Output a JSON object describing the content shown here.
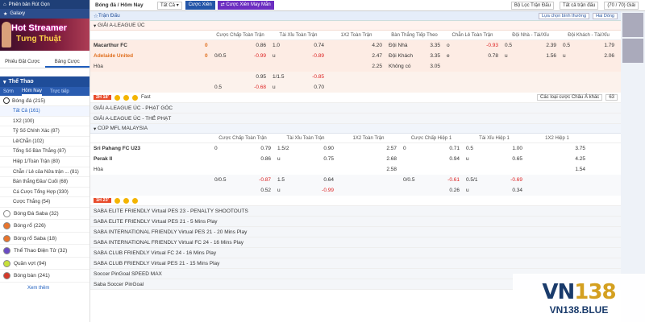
{
  "sidebar": {
    "top1": "Phiên bản Rút Gọn",
    "top2": "Galaxy",
    "banner_line1": "Hot Streamer",
    "banner_line2": "Tưng Thuật",
    "tabs": [
      "Phiếu Đặt Cược",
      "Bảng Cược"
    ],
    "section": "Thể Thao",
    "subtabs": [
      "Sớm",
      "Hôm Nay",
      "Trực tiếp"
    ],
    "main_sport": "Bóng đá (215)",
    "sub_items": [
      "Tất Cả (161)",
      "1X2 (100)",
      "Tỷ Số Chính Xác (87)",
      "Lẻ/Chẵn (102)",
      "Tổng Số Bàn Thắng (87)",
      "Hiệp 1/Toàn Trận (80)",
      "Chẵn / Lẻ của Nửa trận ... (81)",
      "Bàn thắng Đầu/ Cuối (68)",
      "Cá Cược Tổng Hợp (330)",
      "Cược Thắng (54)"
    ],
    "sports": [
      {
        "label": "Bóng Đá Saba (32)",
        "color": "#ffffff"
      },
      {
        "label": "Bóng rổ (226)",
        "color": "#e8742c"
      },
      {
        "label": "Bóng rổ Saba (18)",
        "color": "#e8742c"
      },
      {
        "label": "Thể Thao Điện Tử (32)",
        "color": "#6a4bc4"
      },
      {
        "label": "Quần vợt (94)",
        "color": "#c7e03a"
      },
      {
        "label": "Bóng bàn (241)",
        "color": "#d43a2a"
      }
    ],
    "more": "Xem thêm"
  },
  "topbar": {
    "title": "Bóng đá / Hôm Nay",
    "select": "Tất Cả",
    "btn1": "Cược Xiên",
    "btn2": "Cược Xiên May Mắn",
    "filter": "Bộ Lọc Trận Đấu",
    "all_match": "Tất cả trận đấu",
    "page": "(70 / 70) Giải"
  },
  "main": {
    "header": "Trận Đấu",
    "sort": "Lựa chọn bình thường",
    "odds": "Hai Dòng",
    "league1": "GIẢI A-LEAGUE ÚC",
    "cols1": [
      "Cược Chấp Toàn Trận",
      "Tài Xỉu Toàn Trận",
      "1X2 Toàn Trận",
      "Bàn Thắng Tiếp Theo",
      "Chẵn Lẻ Toàn Trận",
      "Đội Nhà - Tài/Xỉu",
      "Đội Khách - Tài/Xỉu"
    ],
    "m1": {
      "home": "Macarthur FC",
      "away": "Adelaide United",
      "draw": "Hòa",
      "hs": "0",
      "as": "0",
      "rows": [
        [
          "",
          "0.86",
          "1.0",
          "0.74",
          "4.20",
          "Đội Nhà",
          "3.35",
          "o",
          "-0.93",
          "0.5",
          "2.39",
          "0.5",
          "1.79"
        ],
        [
          "0/0.5",
          "-0.99",
          "u",
          "-0.89",
          "2.47",
          "Đội Khách",
          "3.35",
          "e",
          "0.78",
          "u",
          "1.56",
          "u",
          "2.06"
        ],
        [
          "",
          "",
          "",
          "",
          "2.25",
          "Không có",
          "3.05",
          "",
          "",
          "",
          "",
          "",
          ""
        ],
        [
          "",
          "0.95",
          "1/1.5",
          "-0.85",
          "",
          "",
          "",
          "",
          "",
          "",
          "",
          "",
          ""
        ],
        [
          "0.5",
          "-0.68",
          "u",
          "0.70",
          "",
          "",
          "",
          "",
          "",
          "",
          "",
          "",
          ""
        ]
      ],
      "time": "2H 18'",
      "more_bets": "Fast",
      "compare": "Các loại cược Châu Á khác",
      "count": "63"
    },
    "collapsed1": [
      "GIẢI A-LEAGUE ÚC - PHẠT GÓC",
      "GIẢI A-LEAGUE ÚC - THẺ PHẠT"
    ],
    "league2": "CÚP MFL MALAYSIA",
    "cols2": [
      "Cược Chấp Toàn Trận",
      "Tài Xỉu Toàn Trận",
      "1X2 Toàn Trận",
      "Cược Chấp Hiệp 1",
      "Tài Xỉu Hiệp 1",
      "1X2 Hiệp 1"
    ],
    "m2": {
      "home": "Sri Pahang FC U23",
      "away": "Perak II",
      "draw": "Hòa",
      "rows": [
        [
          "0",
          "0.79",
          "1.5/2",
          "0.90",
          "2.57",
          "0",
          "0.71",
          "0.5",
          "1.00",
          "3.75"
        ],
        [
          "",
          "0.86",
          "u",
          "0.75",
          "2.68",
          "",
          "0.94",
          "u",
          "0.65",
          "4.25"
        ],
        [
          "",
          "",
          "",
          "",
          "2.58",
          "",
          "",
          "",
          "",
          "1.54"
        ],
        [
          "0/0.5",
          "-0.87",
          "1.5",
          "0.64",
          "",
          "0/0.5",
          "-0.61",
          "0.5/1",
          "-0.69",
          ""
        ],
        [
          "",
          "0.52",
          "u",
          "-0.99",
          "",
          "",
          "0.26",
          "u",
          "0.34",
          ""
        ]
      ],
      "time": "1H 23'"
    },
    "virtual": [
      "SABA ELITE FRIENDLY Virtual PES 23 - PENALTY SHOOTOUTS",
      "SABA ELITE FRIENDLY Virtual PES 21 - 5 Mins Play",
      "SABA INTERNATIONAL FRIENDLY Virtual PES 21 - 20 Mins Play",
      "SABA INTERNATIONAL FRIENDLY Virtual FC 24 - 16 Mins Play",
      "SABA CLUB FRIENDLY Virtual FC 24 - 16 Mins Play",
      "SABA CLUB FRIENDLY Virtual PES 21 - 15 Mins Play",
      "Soccer PinGoal SPEED MAX",
      "Saba Soccer PinGoal"
    ]
  },
  "logo": {
    "brand_a": "VN",
    "brand_b": "138",
    "site": "VN138.BLUE"
  }
}
